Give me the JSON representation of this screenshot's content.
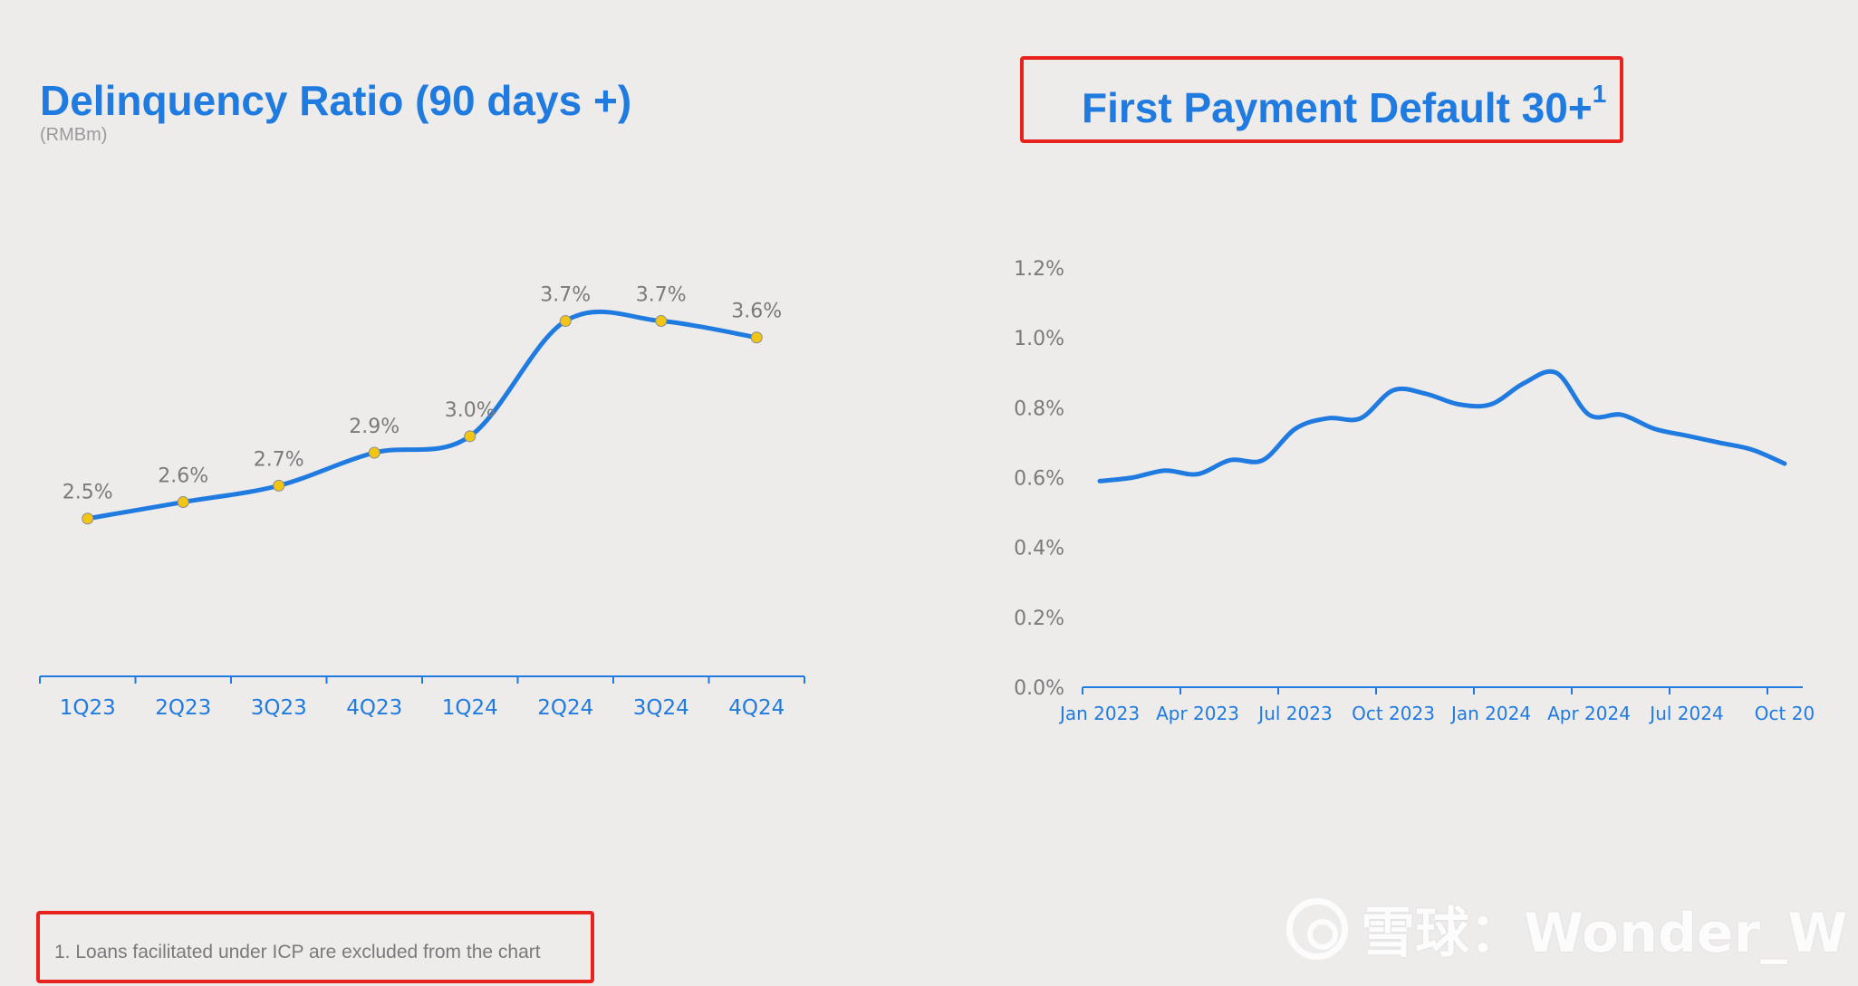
{
  "left_panel": {
    "title": "Delinquency Ratio (90 days +)",
    "subtitle": "(RMBm)"
  },
  "right_panel": {
    "title": "First Payment Default 30+",
    "title_superscript": "1"
  },
  "footnote": "1. Loans facilitated under ICP are excluded from the chart",
  "watermark": "雪球：Wonder_W",
  "colors": {
    "accent": "#1f7be0",
    "line": "#1f7be0",
    "marker": "#f2c414",
    "highlight_box": "#e8231e",
    "axis_text_right": "#7a7a7a",
    "data_label": "#7a7a7a",
    "background": "#eeebeb"
  },
  "chart_data": [
    {
      "type": "line",
      "title": "Delinquency Ratio (90 days +)",
      "subtitle": "(RMBm)",
      "categories": [
        "1Q23",
        "2Q23",
        "3Q23",
        "4Q23",
        "1Q24",
        "2Q24",
        "3Q24",
        "4Q24"
      ],
      "values": [
        2.5,
        2.6,
        2.7,
        2.9,
        3.0,
        3.7,
        3.7,
        3.6
      ],
      "data_labels": [
        "2.5%",
        "2.6%",
        "2.7%",
        "2.9%",
        "3.0%",
        "3.7%",
        "3.7%",
        "3.6%"
      ],
      "ylim": [
        1.8,
        4.0
      ],
      "markers": true,
      "grid": false
    },
    {
      "type": "line",
      "title": "First Payment Default 30+",
      "x": [
        "2023-01",
        "2023-02",
        "2023-03",
        "2023-04",
        "2023-05",
        "2023-06",
        "2023-07",
        "2023-08",
        "2023-09",
        "2023-10",
        "2023-11",
        "2023-12",
        "2024-01",
        "2024-02",
        "2024-03",
        "2024-04",
        "2024-05",
        "2024-06",
        "2024-07",
        "2024-08",
        "2024-09",
        "2024-10"
      ],
      "values": [
        0.59,
        0.6,
        0.62,
        0.61,
        0.65,
        0.65,
        0.74,
        0.77,
        0.77,
        0.85,
        0.84,
        0.81,
        0.81,
        0.87,
        0.9,
        0.78,
        0.78,
        0.74,
        0.72,
        0.7,
        0.68,
        0.64
      ],
      "x_tick_labels": [
        "Jan 2023",
        "Apr 2023",
        "Jul 2023",
        "Oct 2023",
        "Jan 2024",
        "Apr 2024",
        "Jul 2024",
        "Oct 20"
      ],
      "y_tick_labels": [
        "0.0%",
        "0.2%",
        "0.4%",
        "0.6%",
        "0.8%",
        "1.0%",
        "1.2%"
      ],
      "ylim": [
        0,
        1.2
      ],
      "markers": false,
      "grid": false
    }
  ]
}
